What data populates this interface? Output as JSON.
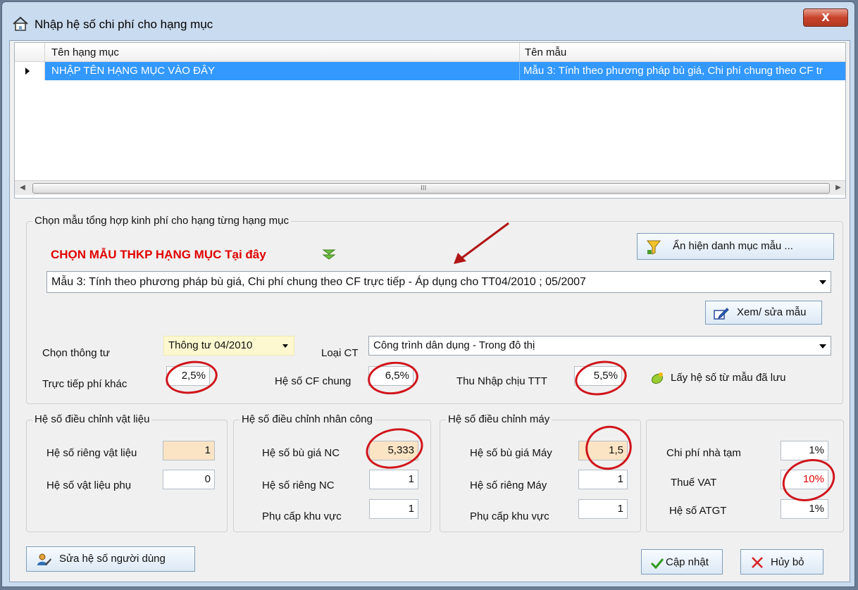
{
  "window": {
    "title": "Nhập hệ số chi phí cho hạng mục",
    "close_label": "X"
  },
  "grid": {
    "columns": [
      "Tên hạng mục",
      "Tên mẫu"
    ],
    "rows": [
      {
        "name": "NHẬP TÊN HẠNG MỤC VÀO ĐÂY",
        "template": "Mẫu 3: Tính theo phương pháp bù giá, Chi phí chung theo CF tr"
      }
    ],
    "scroll_grip": "III"
  },
  "template_group": {
    "title": "Chọn mẫu tổng hợp kinh phí cho hạng từng hạng mục",
    "choose_label": "CHỌN MẪU THKP HẠNG MỤC Tại đây",
    "toggle_button": "Ẩn hiện danh mục mẫu ...",
    "selected_template": "Mẫu 3: Tính theo phương pháp bù giá, Chi phí chung theo CF trực tiếp - Áp dụng cho TT04/2010 ; 05/2007",
    "edit_button": "Xem/ sửa mẫu",
    "circular_label": "Chọn thông tư",
    "circular_value": "Thông tư 04/2010",
    "type_label": "Loại CT",
    "type_value": "Công trình dân dụng - Trong đô thị",
    "direct_other_label": "Trực tiếp phí khác",
    "direct_other_value": "2,5%",
    "general_label": "Hệ số CF chung",
    "general_value": "6,5%",
    "income_label": "Thu Nhập chịu TTT",
    "income_value": "5,5%",
    "load_button": "Lấy hệ số từ mẫu đã lưu"
  },
  "material_group": {
    "title": "Hệ số điều chỉnh vật liệu",
    "own_label": "Hệ số riêng vật liệu",
    "own_value": "1",
    "aux_label": "Hệ số vật liệu phụ",
    "aux_value": "0"
  },
  "labor_group": {
    "title": "Hệ số điều chỉnh nhân công",
    "comp_label": "Hệ số bù giá NC",
    "comp_value": "5,333",
    "own_label": "Hệ số riêng NC",
    "own_value": "1",
    "area_label": "Phụ cấp khu vực",
    "area_value": "1"
  },
  "machine_group": {
    "title": "Hệ số điều chỉnh máy",
    "comp_label": "Hệ số bù giá Máy",
    "comp_value": "1,5",
    "own_label": "Hệ số riêng Máy",
    "own_value": "1",
    "area_label": "Phụ cấp khu vực",
    "area_value": "1"
  },
  "other_group": {
    "temp_label": "Chi phí nhà tạm",
    "temp_value": "1%",
    "vat_label": "Thuế VAT",
    "vat_value": "10%",
    "atgt_label": "Hệ số ATGT",
    "atgt_value": "1%"
  },
  "footer": {
    "user_button": "Sửa hệ số người dùng",
    "update_button": "Cập nhật",
    "cancel_button": "Hủy bỏ"
  },
  "colors": {
    "accent_red": "#e00000",
    "selection_blue": "#3399ff",
    "annotation_red": "#d0151b"
  },
  "icons": [
    "home-icon",
    "funnel-icon",
    "edit-icon",
    "leaf-icon",
    "user-edit-icon",
    "check-icon",
    "x-icon",
    "double-down-arrow-icon",
    "red-arrow-annotation"
  ]
}
